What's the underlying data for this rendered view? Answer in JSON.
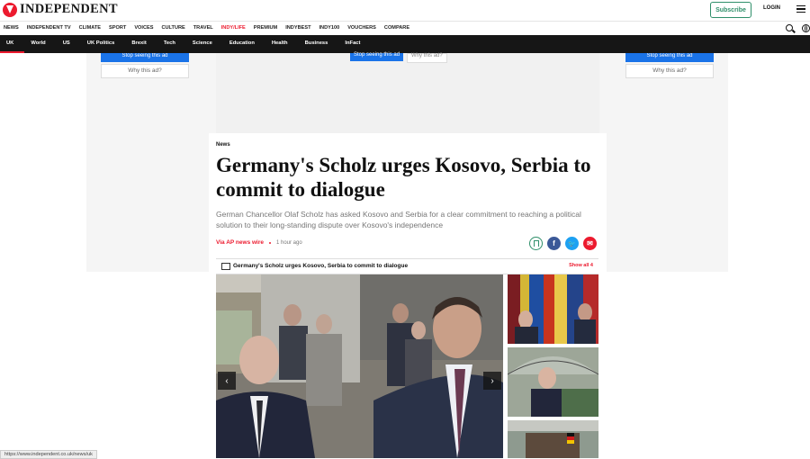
{
  "header": {
    "logo_text": "INDEPENDENT",
    "subscribe_label": "Subscribe",
    "login_label": "LOGIN"
  },
  "nav": {
    "items": [
      "NEWS",
      "INDEPENDENT TV",
      "CLIMATE",
      "SPORT",
      "VOICES",
      "CULTURE",
      "TRAVEL",
      "INDY/LIFE",
      "PREMIUM",
      "INDYBEST",
      "INDY100",
      "VOUCHERS",
      "COMPARE"
    ]
  },
  "subnav": {
    "items": [
      "UK",
      "World",
      "US",
      "UK Politics",
      "Brexit",
      "Tech",
      "Science",
      "Education",
      "Health",
      "Business",
      "InFact"
    ]
  },
  "ads": {
    "stop_label": "Stop seeing this ad",
    "why_label": "Why this ad?",
    "center_why_label": "Why this ad?"
  },
  "article": {
    "section": "News",
    "headline": "Germany's Scholz urges Kosovo, Serbia to commit to dialogue",
    "standfirst": "German Chancellor Olaf Scholz has asked Kosovo and Serbia  for a clear commitment to reaching a political solution to their long-standing dispute over Kosovo's independence",
    "source": "Via AP news wire",
    "time": "1 hour ago"
  },
  "gallery": {
    "title": "Germany's Scholz urges Kosovo, Serbia to commit to dialogue",
    "show_all": "Show all 4"
  },
  "status_bar": {
    "url": "https://www.independent.co.uk/news/uk"
  },
  "colors": {
    "brand_red": "#ec1a2e",
    "subnav_bg": "#161616",
    "subscribe_green": "#2f8f6a"
  }
}
